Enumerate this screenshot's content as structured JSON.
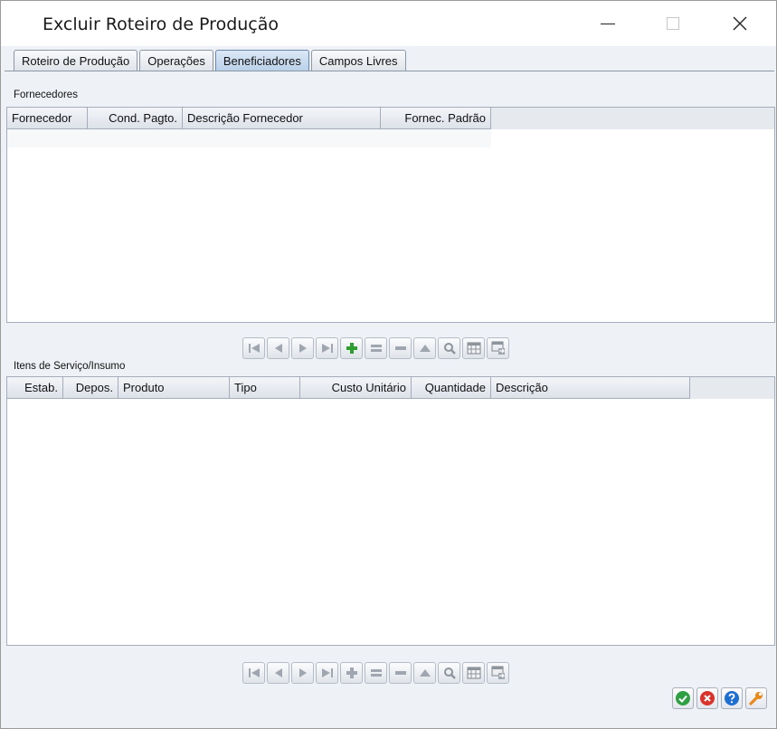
{
  "window": {
    "title": "Excluir Roteiro de Produção"
  },
  "tabs": [
    {
      "label": "Roteiro de Produção",
      "active": false
    },
    {
      "label": "Operações",
      "active": false
    },
    {
      "label": "Beneficiadores",
      "active": true
    },
    {
      "label": "Campos Livres",
      "active": false
    }
  ],
  "fornecedores": {
    "label": "Fornecedores",
    "columns": [
      "Fornecedor",
      "Cond. Pagto.",
      "Descrição Fornecedor",
      "Fornec. Padrão"
    ],
    "rows": []
  },
  "itens": {
    "label": "Itens de Serviço/Insumo",
    "columns": [
      "Estab.",
      "Depos.",
      "Produto",
      "Tipo",
      "Custo Unitário",
      "Quantidade",
      "Descrição"
    ],
    "rows": []
  },
  "toolbar_icons": [
    "first-icon",
    "previous-icon",
    "next-icon",
    "last-icon",
    "add-icon",
    "edit-icon",
    "remove-icon",
    "up-icon",
    "search-icon",
    "grid-icon",
    "export-icon"
  ],
  "colors": {
    "add_active": "#2e9e2e",
    "ok": "#2ea043",
    "cancel": "#d9342b",
    "help": "#1f6fd1",
    "settings": "#e8891c"
  }
}
